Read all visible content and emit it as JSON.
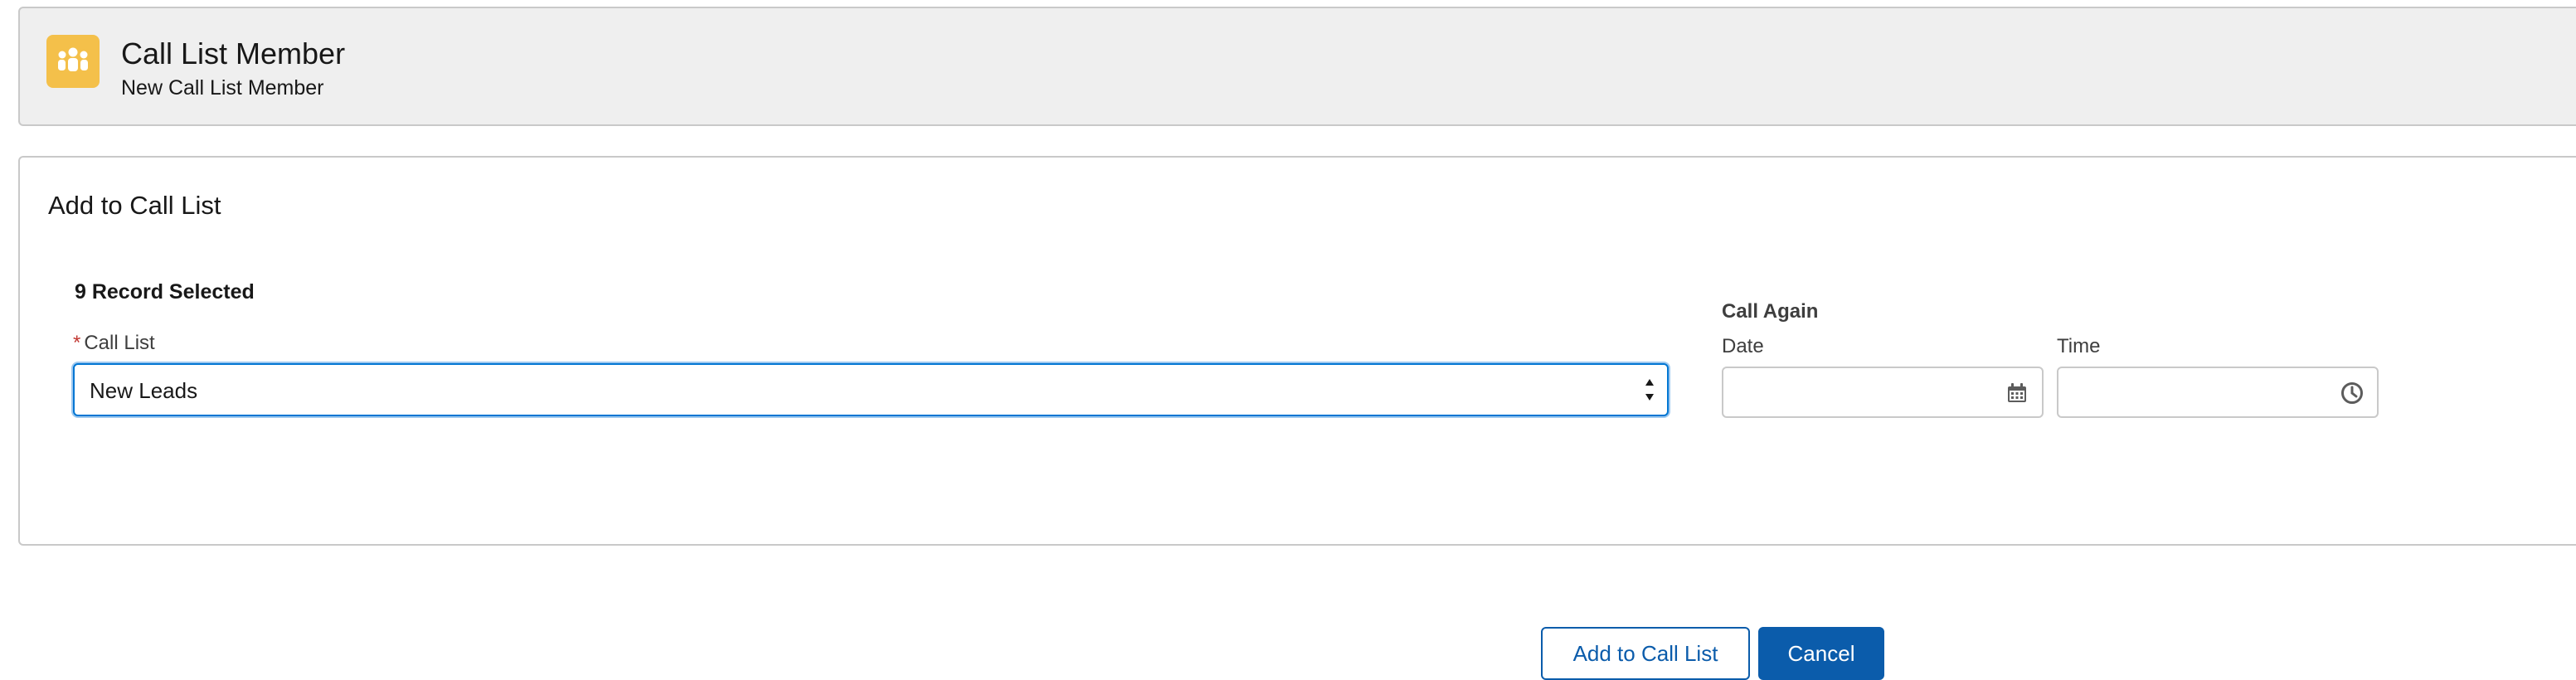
{
  "header": {
    "title": "Call List Member",
    "subtitle": "New Call List Member",
    "icon": "people-icon",
    "icon_color": "#f4c04a"
  },
  "card": {
    "title": "Add to Call List",
    "records_selected": "9 Record Selected"
  },
  "call_list": {
    "required_marker": "*",
    "label": "Call List",
    "value": "New Leads"
  },
  "call_again": {
    "label": "Call Again",
    "date_label": "Date",
    "date_value": "",
    "time_label": "Time",
    "time_value": ""
  },
  "actions": {
    "add_label": "Add to Call List",
    "cancel_label": "Cancel"
  },
  "colors": {
    "brand": "#0b5cab",
    "focus_border": "#0176d3",
    "header_bg": "#efefef",
    "required": "#c23934"
  }
}
